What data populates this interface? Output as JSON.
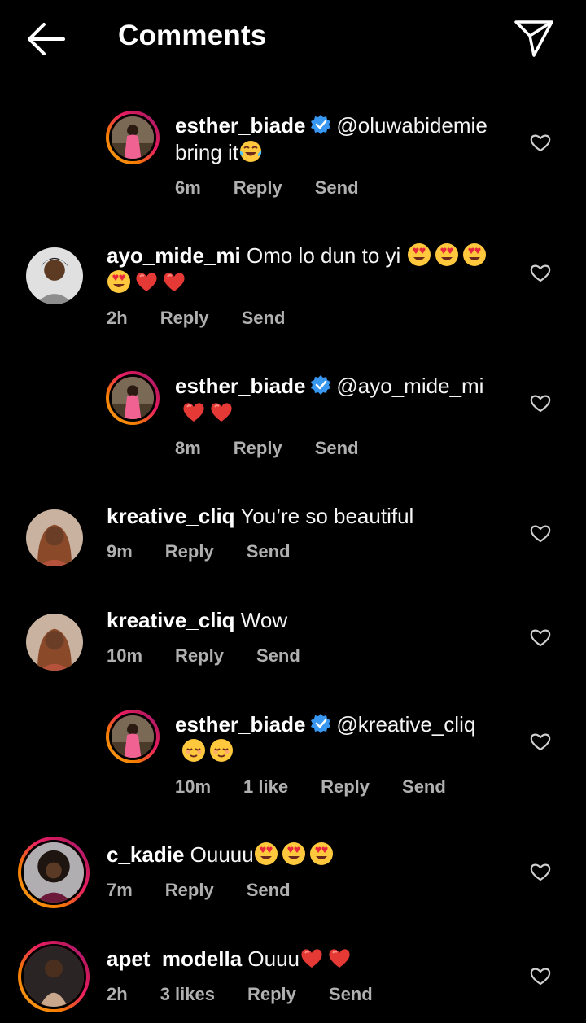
{
  "header": {
    "title": "Comments",
    "back_icon": "arrow-left-icon",
    "share_icon": "paper-plane-icon"
  },
  "colors": {
    "background": "#000000",
    "text": "#ffffff",
    "meta": "#b0b0b0",
    "verified": "#3897f0",
    "heart_emoji": "#e53935"
  },
  "comments": [
    {
      "username": "esther_biade",
      "verified": true,
      "text": "@oluwabidemie bring it",
      "emojis": [
        "face-with-tears-of-joy"
      ],
      "time": "6m",
      "likes": "",
      "reply": "Reply",
      "send": "Send",
      "is_reply": true
    },
    {
      "username": "ayo_mide_mi",
      "verified": false,
      "text": "Omo lo dun to yi",
      "emojis": [
        "heart-eyes",
        "heart-eyes",
        "heart-eyes",
        "heart-eyes",
        "red-heart",
        "red-heart"
      ],
      "time": "2h",
      "likes": "",
      "reply": "Reply",
      "send": "Send",
      "is_reply": false
    },
    {
      "username": "esther_biade",
      "verified": true,
      "text": "@ayo_mide_mi",
      "emojis": [
        "red-heart",
        "red-heart"
      ],
      "time": "8m",
      "likes": "",
      "reply": "Reply",
      "send": "Send",
      "is_reply": true
    },
    {
      "username": "kreative_cliq",
      "verified": false,
      "text": "You’re so beautiful",
      "emojis": [],
      "time": "9m",
      "likes": "",
      "reply": "Reply",
      "send": "Send",
      "is_reply": false
    },
    {
      "username": "kreative_cliq",
      "verified": false,
      "text": "Wow",
      "emojis": [],
      "time": "10m",
      "likes": "",
      "reply": "Reply",
      "send": "Send",
      "is_reply": false
    },
    {
      "username": "esther_biade",
      "verified": true,
      "text": "@kreative_cliq",
      "emojis": [
        "relieved-face",
        "relieved-face"
      ],
      "time": "10m",
      "likes": "1 like",
      "reply": "Reply",
      "send": "Send",
      "is_reply": true
    },
    {
      "username": "c_kadie",
      "verified": false,
      "text": "Ouuuu",
      "emojis": [
        "heart-eyes",
        "heart-eyes",
        "heart-eyes"
      ],
      "time": "7m",
      "likes": "",
      "reply": "Reply",
      "send": "Send",
      "is_reply": false
    },
    {
      "username": "apet_modella",
      "verified": false,
      "text": "Ouuu",
      "emojis": [
        "red-heart",
        "red-heart"
      ],
      "time": "2h",
      "likes": "3 likes",
      "reply": "Reply",
      "send": "Send",
      "is_reply": false
    }
  ]
}
